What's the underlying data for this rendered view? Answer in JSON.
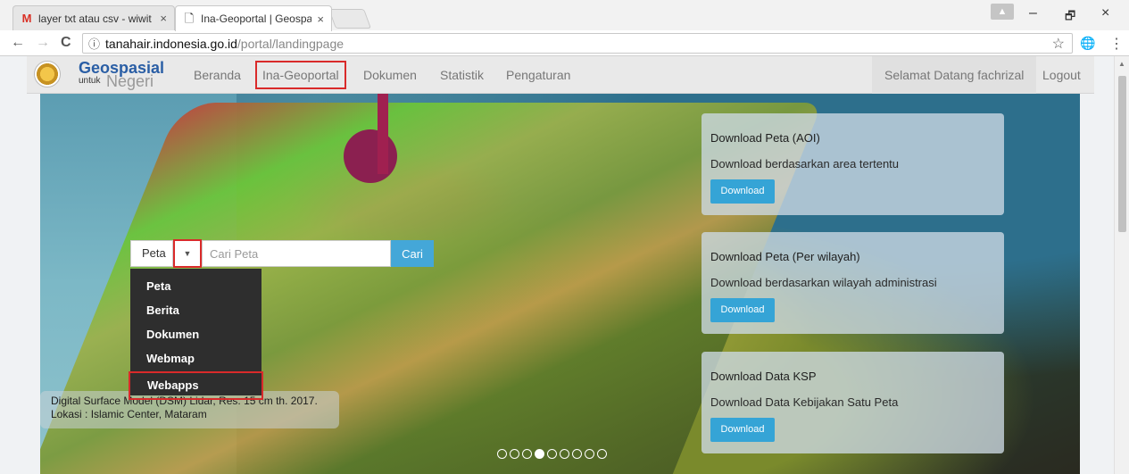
{
  "browser": {
    "tabs": [
      {
        "favicon": "M",
        "title": "layer txt atau csv - wiwit",
        "close": "×"
      },
      {
        "favicon": "🗋",
        "title": "Ina-Geoportal | Geospasi",
        "close": "×"
      }
    ],
    "url_host": "tanahair.indonesia.go.id",
    "url_path": "/portal/landingpage",
    "info_icon": "ⓘ",
    "bookmark_star": "☆",
    "back": "←",
    "forward": "→",
    "reload": "C",
    "window_controls": {
      "minimize": "–",
      "restore": "🗗",
      "close": "×"
    },
    "globe": "🌐",
    "menu": "⋮",
    "user": "▲"
  },
  "site": {
    "brand_line1": "Geospasial",
    "brand_line2": "untuk",
    "brand_line3": "Negeri",
    "nav": [
      "Beranda",
      "Ina-Geoportal",
      "Dokumen",
      "Statistik",
      "Pengaturan"
    ],
    "welcome": "Selamat Datang fachrizal",
    "logout": "Logout"
  },
  "search": {
    "selected": "Peta",
    "caret": "▼",
    "placeholder": "Cari Peta",
    "button": "Cari",
    "options": [
      "Peta",
      "Berita",
      "Dokumen",
      "Webmap",
      "Webapps"
    ]
  },
  "caption": {
    "line1": "Digital Surface Model (DSM) Lidar, Res. 15 cm th. 2017.",
    "line2": "Lokasi : Islamic Center, Mataram"
  },
  "panels": [
    {
      "title": "Download Peta (AOI)",
      "desc": "Download berdasarkan area tertentu",
      "button": "Download"
    },
    {
      "title": "Download Peta (Per wilayah)",
      "desc": "Download berdasarkan wilayah administrasi",
      "button": "Download"
    },
    {
      "title": "Download Data KSP",
      "desc": "Download Data Kebijakan Satu Peta",
      "button": "Download"
    }
  ],
  "carousel": {
    "total": 9,
    "active": 3
  }
}
